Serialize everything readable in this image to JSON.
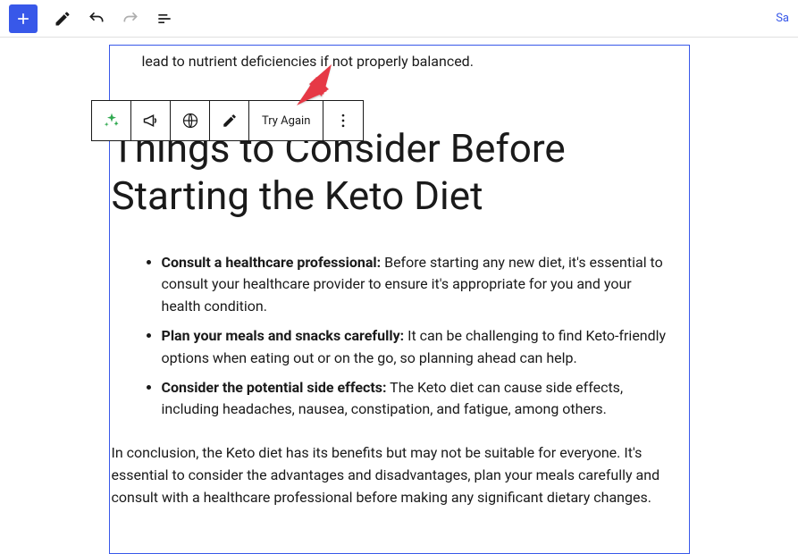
{
  "toolbar": {
    "save_label": "Sa"
  },
  "floating": {
    "try_again_label": "Try Again"
  },
  "doc": {
    "truncated_prefix": "lead to nutrient deficiencies if not ",
    "truncated_suffix": "properly balanced.",
    "heading": "Things to Consider Before Starting the Keto Diet",
    "bullets": [
      {
        "bold": "Consult a healthcare professional:",
        "text": " Before starting any new diet, it's essential to consult your healthcare provider to ensure it's appropriate for you and your health condition."
      },
      {
        "bold": "Plan your meals and snacks carefully:",
        "text": " It can be challenging to find Keto-friendly options when eating out or on the go, so planning ahead can help."
      },
      {
        "bold": "Consider the potential side effects:",
        "text": " The Keto diet can cause side effects, including headaches, nausea, constipation, and fatigue, among others."
      }
    ],
    "conclusion": "In conclusion, the Keto diet has its benefits but may not be suitable for everyone. It's essential to consider the advantages and disadvantages, plan your meals carefully and consult with a healthcare professional before making any significant dietary changes."
  },
  "colors": {
    "accent": "#3858e9",
    "arrow": "#e63946"
  }
}
